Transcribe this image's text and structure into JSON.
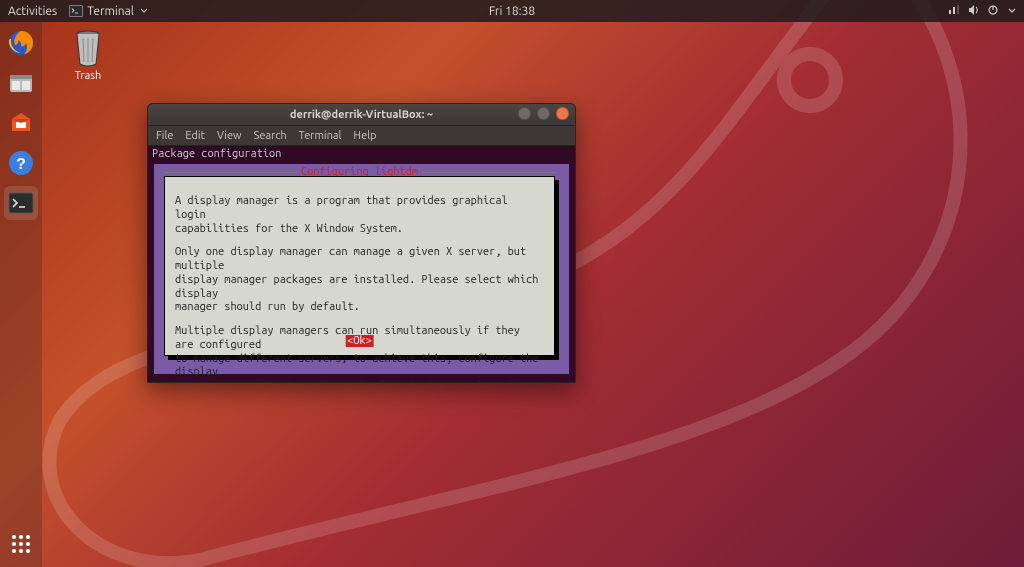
{
  "topbar": {
    "activities": "Activities",
    "app_indicator": "Terminal",
    "clock": "Fri 18:38"
  },
  "launcher": {
    "items": [
      {
        "name": "firefox",
        "title": "Firefox"
      },
      {
        "name": "files",
        "title": "Files"
      },
      {
        "name": "software",
        "title": "Ubuntu Software"
      },
      {
        "name": "help",
        "title": "Help"
      },
      {
        "name": "terminal",
        "title": "Terminal",
        "running": true
      }
    ],
    "apps_tooltip": "Show Applications"
  },
  "desktop": {
    "trash_label": "Trash"
  },
  "window": {
    "title": "derrik@derrik-VirtualBox: ~",
    "menu": [
      "File",
      "Edit",
      "View",
      "Search",
      "Terminal",
      "Help"
    ],
    "header_line": "Package configuration",
    "dialog": {
      "title": "Configuring lightdm",
      "paragraph1": "A display manager is a program that provides graphical login\ncapabilities for the X Window System.",
      "paragraph2": "Only one display manager can manage a given X server, but multiple\ndisplay manager packages are installed. Please select which display\nmanager should run by default.",
      "paragraph3": "Multiple display managers can run simultaneously if they are configured\nto manage different servers; to achieve this, configure the display\nmanagers accordingly, edit each of their init scripts in /etc/init.d,\nand disable the check for a default display manager.",
      "ok_label": "<Ok>"
    }
  }
}
